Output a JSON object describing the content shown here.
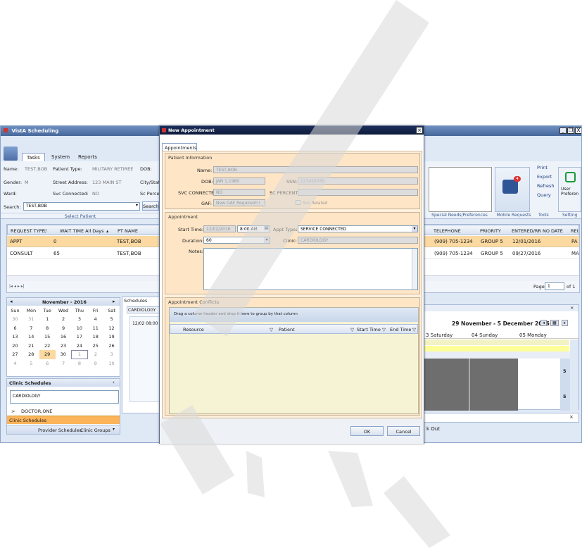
{
  "app": {
    "title": "VistA Scheduling",
    "window_controls": [
      "_",
      "à",
      "X"
    ],
    "tabs": [
      "Tasks",
      "System",
      "Reports"
    ],
    "patient": {
      "name_label": "Name:",
      "name": "TEST,BOB",
      "pt_type_label": "Patient Type:",
      "pt_type": "MILITARY RETIREE",
      "dob_label": "DOB:",
      "gender_label": "Gender:",
      "gender": "M",
      "street_label": "Street Address:",
      "street": "123 MAIN ST",
      "city_label": "City/State",
      "ward_label": "Ward:",
      "svc_label": "Svc Connected:",
      "svc": "NO",
      "sc_label": "Sc Percent"
    },
    "search_label": "Search:",
    "search_value": "TEST,BOB",
    "search_button": "Search",
    "select_patient": "Select Patient",
    "tools": [
      "Print",
      "Export",
      "Refresh",
      "Query"
    ],
    "user_prefs_label": "User Preferen",
    "group_labels": {
      "special": "Special Needs/Preferences",
      "mobile": "Mobile Requests",
      "tools": "Tools",
      "settings": "Setting"
    },
    "badge": "4",
    "request_grid": {
      "headers_left": [
        "REQUEST TYPE",
        "WAIT TIME All Days",
        "PT NAME"
      ],
      "headers_right": [
        "TELEPHONE",
        "PRIORITY",
        "ENTERED/RR NO DATE",
        "REI"
      ],
      "rows": [
        {
          "type": "APPT",
          "wait": "0",
          "name": "TEST,BOB",
          "phone": "(909) 705-1234",
          "priority": "GROUP 5",
          "date": "12/01/2016",
          "extra": "PA"
        },
        {
          "type": "CONSULT",
          "wait": "65",
          "name": "TEST,BOB",
          "phone": "(909) 705-1234",
          "priority": "GROUP 5",
          "date": "09/27/2016",
          "extra": "MA"
        }
      ],
      "page_label": "Page",
      "page_value": "1",
      "page_of": "of 1"
    },
    "calendar": {
      "month": "November - 2016",
      "days": [
        "Sun",
        "Mon",
        "Tue",
        "Wed",
        "Thu",
        "Fri",
        "Sat"
      ],
      "weeks": [
        [
          "30",
          "31",
          "1",
          "2",
          "3",
          "4",
          "5"
        ],
        [
          "6",
          "7",
          "8",
          "9",
          "10",
          "11",
          "12"
        ],
        [
          "13",
          "14",
          "15",
          "16",
          "17",
          "18",
          "19"
        ],
        [
          "20",
          "21",
          "22",
          "23",
          "24",
          "25",
          "26"
        ],
        [
          "27",
          "28",
          "29",
          "30",
          "1",
          "2",
          "3"
        ],
        [
          "4",
          "5",
          "6",
          "7",
          "8",
          "9",
          "10"
        ]
      ]
    },
    "clinic_schedules": {
      "title": "Clinic Schedules",
      "clinic": "CARDIOLOGY",
      "provider": "DOCTOR,ONE",
      "nav_selected": "Clinic Schedules",
      "nav_items": [
        "Provider Schedules",
        "Clinic Groups"
      ]
    },
    "schedules": {
      "title": "Schedules",
      "tab": "CARDIOLOGY",
      "slot": "12/02 08:00"
    },
    "week_view": {
      "range": "29 November - 5 December 2016",
      "days": [
        "3 Saturday",
        "04 Sunday",
        "05 Monday"
      ],
      "row_nums": [
        "5",
        "5"
      ]
    },
    "check_out": "k Out"
  },
  "dialog": {
    "title": "New Appointment",
    "tab": "Appointments",
    "patient_info": {
      "title": "Patient Information",
      "name_label": "Name:",
      "name": "TEST,BOB",
      "dob_label": "DOB:",
      "dob": "JAN 1,1980",
      "ssn_label": "SSN:",
      "ssn": "123456789",
      "svc_label": "SVC CONNECTED:",
      "svc": "NO",
      "sc_label": "SC PERCENT:",
      "gaf_label": "GAF:",
      "gaf": "New GAF Required!!!",
      "svc_related": "Svc Related"
    },
    "appointment": {
      "title": "Appointment",
      "start_label": "Start Time:",
      "start_date": "12/02/2016",
      "start_time": "8:00 AM",
      "type_label": "Appt Type:",
      "type": "SERVICE CONNECTED",
      "duration_label": "Duration:",
      "duration": "60",
      "clinic_label": "Clinic:",
      "clinic": "CARDIOLOGY",
      "notes_label": "Notes:"
    },
    "conflicts": {
      "title": "Appointment Conflicts",
      "group_hint": "Drag a column header and drop it here to group by that column",
      "headers": [
        "Resource",
        "Patient",
        "Start Time",
        "End Time"
      ]
    },
    "ok": "OK",
    "cancel": "Cancel"
  },
  "watermark": "DRAFT",
  "colors": {
    "selected_row": "#fbd9a0",
    "dialog_panel": "#fde5c6",
    "title_bar": "#45679a",
    "watermark": "#d9d9d9"
  }
}
